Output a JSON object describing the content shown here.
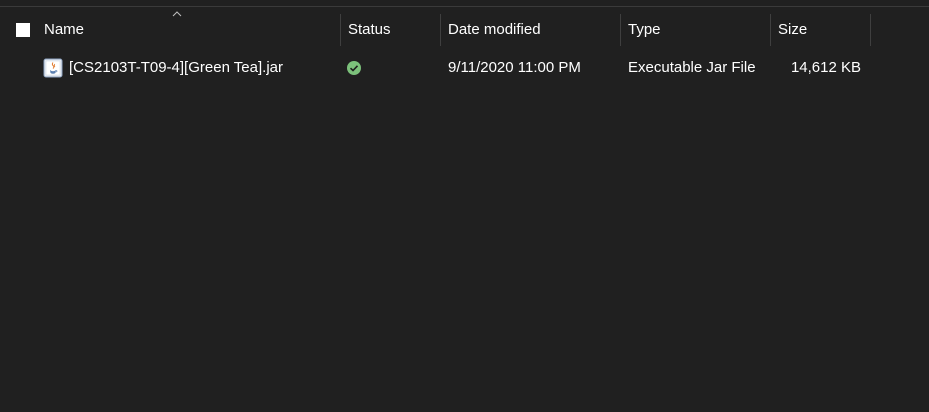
{
  "columns": {
    "name": "Name",
    "status": "Status",
    "date_modified": "Date modified",
    "type": "Type",
    "size": "Size"
  },
  "sort": {
    "column": "name",
    "direction": "ascending",
    "icon": "chevron-up-icon"
  },
  "files": [
    {
      "icon": "java-jar-file-icon",
      "name": "[CS2103T-T09-4][Green Tea].jar",
      "status_icon": "synced-check-icon",
      "date_modified": "9/11/2020 11:00 PM",
      "type": "Executable Jar File",
      "size": "14,612 KB"
    }
  ],
  "colors": {
    "background": "#202020",
    "text": "#ffffff",
    "separator": "#3f3f3f",
    "status_ok": "#7cc17b"
  }
}
